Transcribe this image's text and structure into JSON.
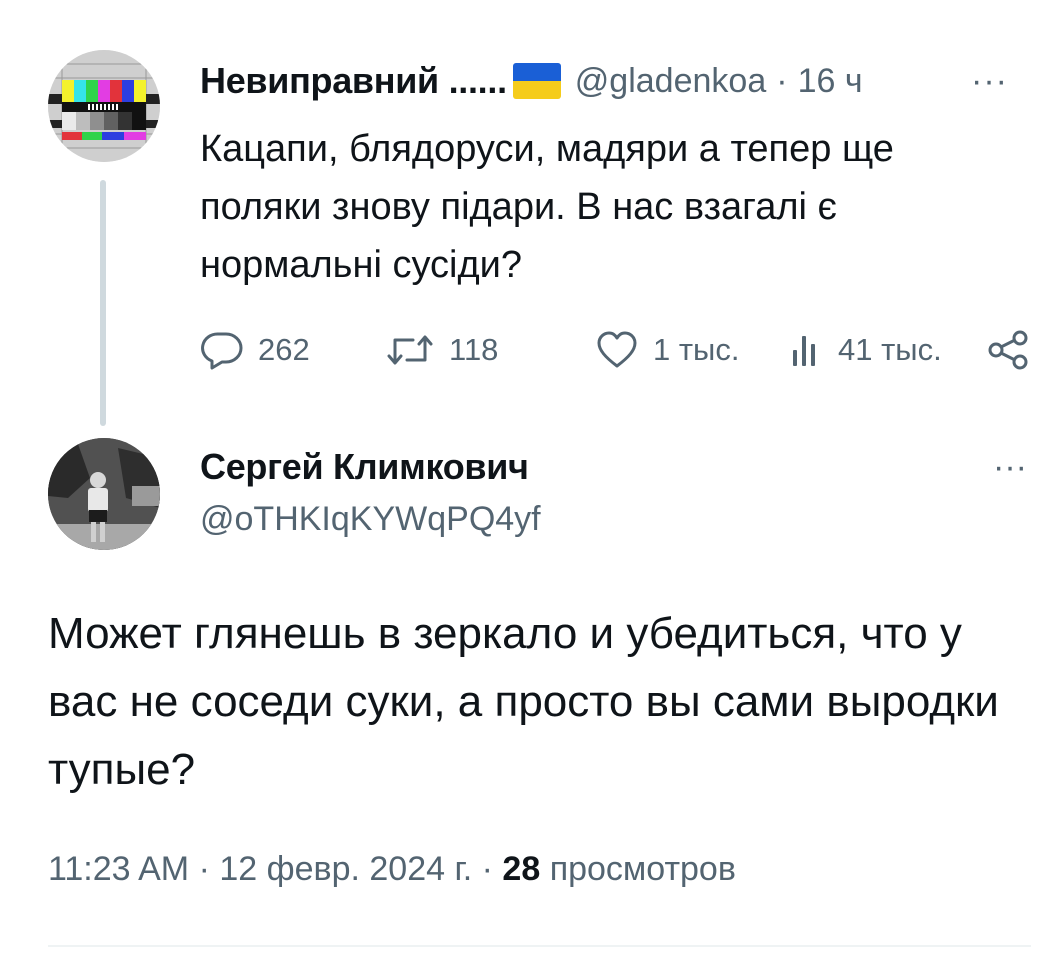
{
  "parent_tweet": {
    "author_name": "Невиправний ......",
    "author_handle": "@gladenkoa",
    "separator": "·",
    "time_ago": "16 ч",
    "more_label": "···",
    "text": "Кацапи, блядоруси, мадяри а тепер ще поляки знову підари. В нас взагалі є нормальні сусіди?",
    "flag_colors": {
      "top": "#1a5fd6",
      "bottom": "#f5cc1b"
    },
    "actions": {
      "replies": {
        "icon": "reply-icon",
        "count": "262"
      },
      "reposts": {
        "icon": "repost-icon",
        "count": "118"
      },
      "likes": {
        "icon": "heart-icon",
        "count": "1 тыс."
      },
      "views": {
        "icon": "views-icon",
        "count": "41 тыс."
      },
      "share": {
        "icon": "share-icon"
      }
    }
  },
  "reply_tweet": {
    "author_name": "Сергей Климкович",
    "author_handle": "@oTHKIqKYWqPQ4yf",
    "more_label": "···",
    "text": "Может глянешь в зеркало и убедиться, что у вас не соседи суки, а просто вы сами выродки тупые?",
    "time": "11:23 AM",
    "separator": "·",
    "date": "12 февр. 2024 г.",
    "views_count": "28",
    "views_label": "просмотров"
  },
  "colors": {
    "text_primary": "#0f1419",
    "text_secondary": "#536471",
    "thread_line": "#cfd9de"
  }
}
